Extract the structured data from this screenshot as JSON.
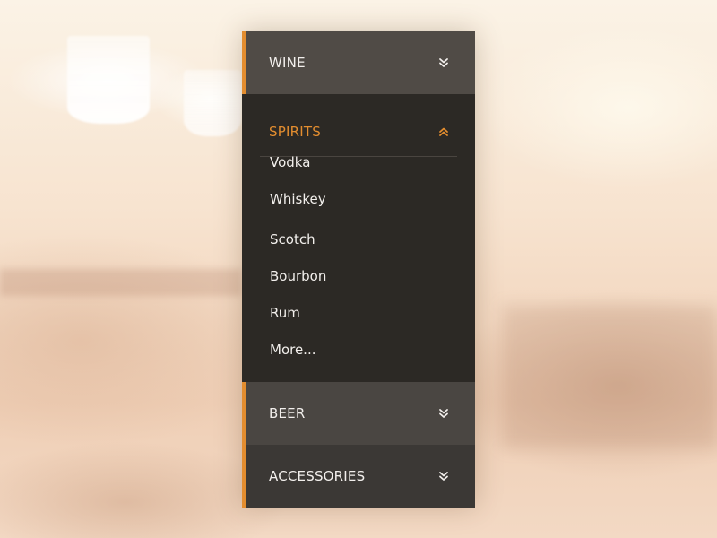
{
  "menu": {
    "wine": {
      "label": "WINE",
      "icon": "double-chevron-down-icon"
    },
    "spirits": {
      "label": "SPIRITS",
      "icon": "double-chevron-up-icon",
      "items": [
        "Vodka",
        "Whiskey",
        "Scotch",
        "Bourbon",
        "Rum",
        "More..."
      ]
    },
    "beer": {
      "label": "BEER",
      "icon": "double-chevron-down-icon"
    },
    "accessories": {
      "label": "ACCESSORIES",
      "icon": "double-chevron-down-icon"
    }
  },
  "colors": {
    "accent": "#e38d2f",
    "header_dark": "#504b46",
    "panel_dark": "#2c2925",
    "text_light": "#f2efec"
  }
}
